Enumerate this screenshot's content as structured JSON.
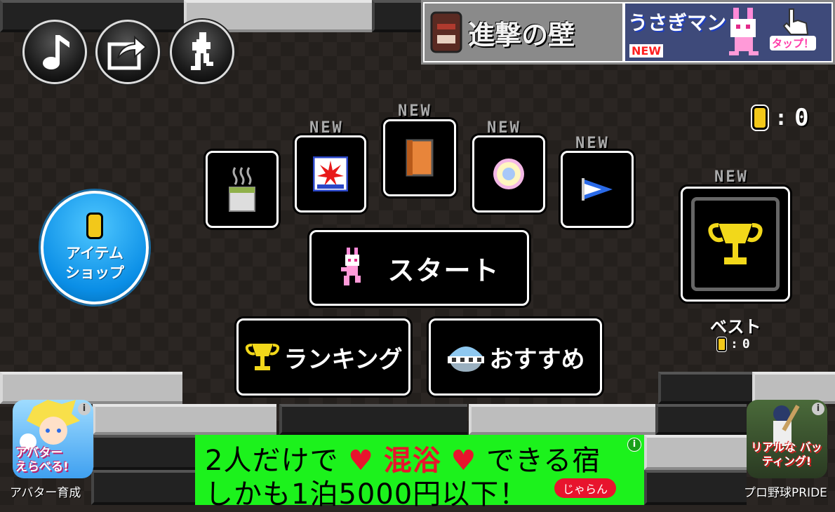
{
  "top_left_buttons": {
    "music_icon": "music-note-icon",
    "share_icon": "share-icon",
    "character_icon": "runner-silhouette-icon"
  },
  "ad_top": {
    "left_text": "進撃の壁",
    "right_text": "うさぎマン",
    "new_badge": "NEW",
    "tap_label": "タップ！"
  },
  "coin_counter": {
    "coins": "0",
    "separator": ":",
    "value": "0"
  },
  "items": {
    "new_label": "NEW",
    "slots": [
      {
        "icon": "steaming-cup-icon",
        "new": false
      },
      {
        "icon": "red-sticker-card-icon",
        "new": true
      },
      {
        "icon": "orange-book-icon",
        "new": true
      },
      {
        "icon": "pink-donut-icon",
        "new": true
      },
      {
        "icon": "blue-flag-icon",
        "new": true
      }
    ]
  },
  "shop_button": {
    "line1": "アイテム",
    "line2": "ショップ"
  },
  "start_button": {
    "label": "スタート"
  },
  "ranking_button": {
    "label": "ランキング"
  },
  "recommend_button": {
    "label": "おすすめ"
  },
  "best": {
    "new_label": "NEW",
    "label": "ベスト",
    "coin_score": "0",
    "separator": ":",
    "value": "0"
  },
  "ad_bottom": {
    "line1_a": "2人だけで",
    "line1_b": "混浴",
    "line1_c": "できる宿",
    "line2": "しかも1泊5000円以下！",
    "brand": "じゃらん"
  },
  "side_ads": {
    "left_overlay": "アバター えらべる!",
    "left_label": "アバター育成",
    "right_overlay": "リアルな バッティング!",
    "right_label": "プロ野球PRIDE"
  },
  "colors": {
    "accent_blue": "#0a8ee6",
    "ad_green": "#1cf21c",
    "trophy_yellow": "#f2d81a",
    "heart_red": "#e8142d"
  }
}
